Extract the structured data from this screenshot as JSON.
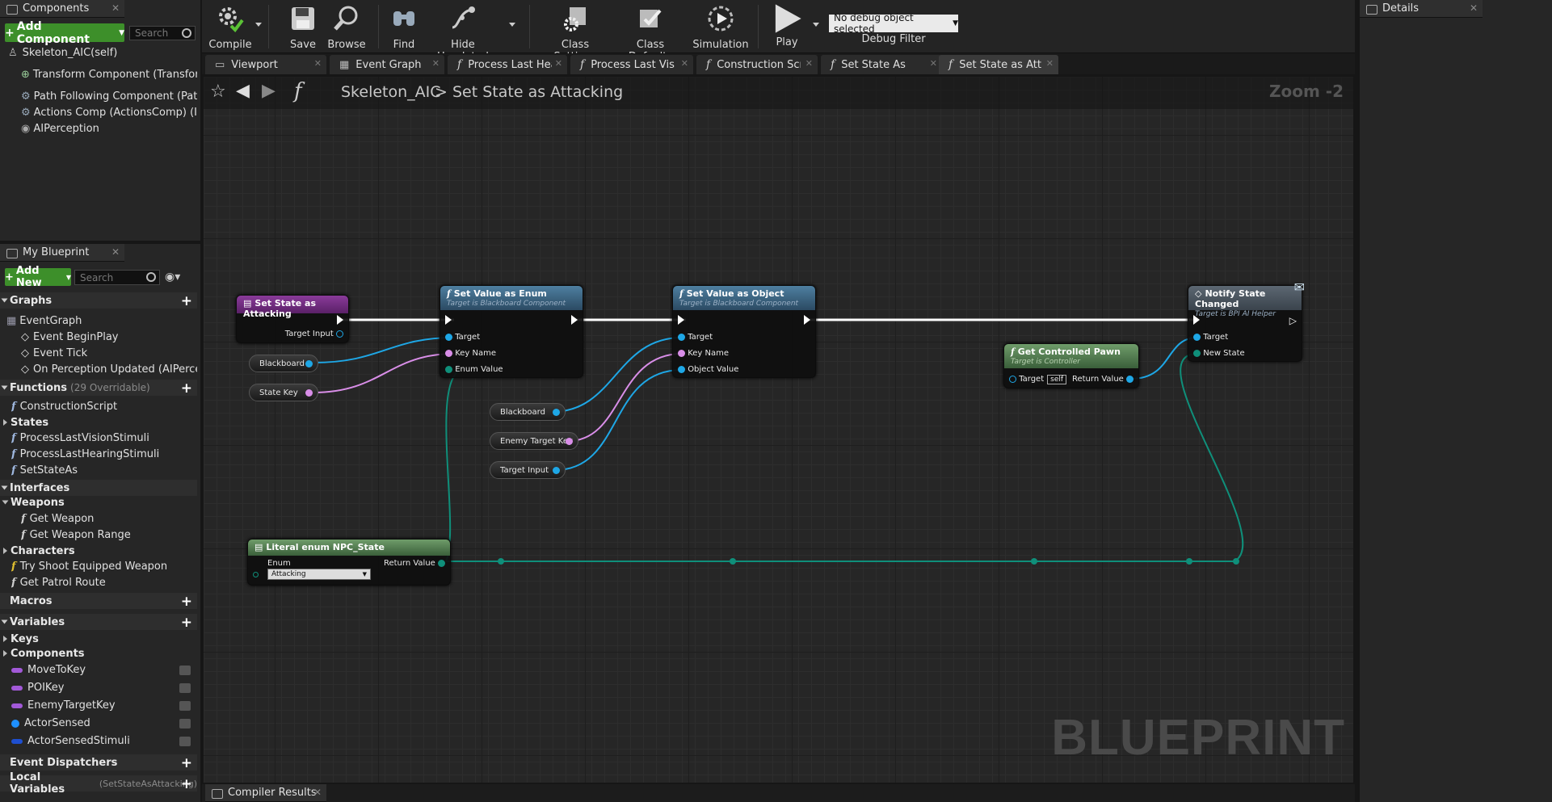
{
  "components": {
    "tab": "Components",
    "add_label": "Add Component",
    "search_placeholder": "Search",
    "root": "Skeleton_AIC(self)",
    "items": [
      "Transform Component (TransformComponent)",
      "Path Following Component (PathFollowingComponent)",
      "Actions Comp (ActionsComp) (Inherited)",
      "AIPerception"
    ]
  },
  "myblueprint": {
    "tab": "My Blueprint",
    "add_label": "Add New",
    "search_placeholder": "Search",
    "graphs_label": "Graphs",
    "event_graph": "EventGraph",
    "events": [
      "Event BeginPlay",
      "Event Tick",
      "On Perception Updated (AIPerception)"
    ],
    "functions_label": "Functions",
    "functions_sub": "(29 Overridable)",
    "construction": "ConstructionScript",
    "states_label": "States",
    "state_funcs": [
      "ProcessLastVisionStimuli",
      "ProcessLastHearingStimuli",
      "SetStateAs"
    ],
    "interfaces_label": "Interfaces",
    "weapons_label": "Weapons",
    "weapon_funcs": [
      "Get Weapon",
      "Get Weapon Range"
    ],
    "characters_label": "Characters",
    "character_funcs": [
      "Try Shoot Equipped Weapon",
      "Get Patrol Route"
    ],
    "macros_label": "Macros",
    "variables_label": "Variables",
    "keys_label": "Keys",
    "components_label": "Components",
    "vars": [
      {
        "name": "MoveToKey",
        "color": "#a259d8"
      },
      {
        "name": "POIKey",
        "color": "#a259d8"
      },
      {
        "name": "EnemyTargetKey",
        "color": "#a259d8"
      },
      {
        "name": "ActorSensed",
        "color": "#1e90ff"
      },
      {
        "name": "ActorSensedStimuli",
        "color": "#1e4fd0"
      }
    ],
    "dispatchers_label": "Event Dispatchers",
    "locals_label": "Local Variables",
    "locals_sub": "(SetStateAsAttacking)"
  },
  "toolbar": {
    "compile": "Compile",
    "save": "Save",
    "browse": "Browse",
    "find": "Find",
    "hide_unrelated": "Hide Unrelated",
    "class_settings": "Class Settings",
    "class_defaults": "Class Defaults",
    "simulation": "Simulation",
    "play": "Play",
    "debug_select": "No debug object selected",
    "debug_filter": "Debug Filter"
  },
  "doc_tabs": [
    "Viewport",
    "Event Graph",
    "Process Last Hearing",
    "Process Last Vision",
    "Construction Script",
    "Set State As",
    "Set State as Attacking"
  ],
  "graph": {
    "crumb_root": "Skeleton_AIC",
    "crumb_sep": ">",
    "crumb_current": "Set State as Attacking",
    "zoom": "Zoom -2",
    "watermark": "BLUEPRINT"
  },
  "nodes": {
    "entry": {
      "title": "Set State as Attacking",
      "pin": "Target Input"
    },
    "blackboard1": "Blackboard",
    "statekey": "State Key",
    "enum_node": {
      "title": "Set Value as Enum",
      "sub": "Target is Blackboard Component",
      "pins": [
        "Target",
        "Key Name",
        "Enum Value"
      ]
    },
    "blackboard2": "Blackboard",
    "enemykey": "Enemy Target Key",
    "targetinput": "Target Input",
    "obj_node": {
      "title": "Set Value as Object",
      "sub": "Target is Blackboard Component",
      "pins": [
        "Target",
        "Key Name",
        "Object Value"
      ]
    },
    "pawn_node": {
      "title": "Get Controlled Pawn",
      "sub": "Target is Controller",
      "target": "Target",
      "self": "self",
      "ret": "Return Value"
    },
    "notify_node": {
      "title": "Notify State Changed",
      "sub": "Target is BPI AI Helper",
      "pins": [
        "Target",
        "New State"
      ]
    },
    "literal_node": {
      "title": "Literal enum NPC_State",
      "enum": "Enum",
      "value": "Attacking",
      "ret": "Return Value"
    }
  },
  "details_tab": "Details",
  "bottom_tab": "Compiler Results"
}
